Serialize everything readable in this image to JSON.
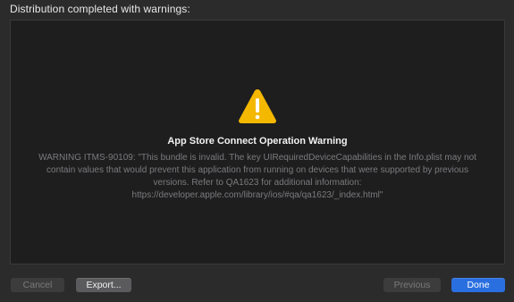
{
  "dialog": {
    "heading": "Distribution completed with warnings:"
  },
  "warning": {
    "icon": "warning-triangle-icon",
    "title": "App Store Connect Operation Warning",
    "message": "WARNING ITMS-90109: \"This bundle is invalid. The key UIRequiredDeviceCapabilities in the Info.plist may not contain values that would prevent this application from running on devices that were supported by previous versions. Refer to QA1623 for additional information: https://developer.apple.com/library/ios/#qa/qa1623/_index.html\"",
    "icon_color": "#f5b800"
  },
  "buttons": {
    "cancel": "Cancel",
    "export": "Export...",
    "previous": "Previous",
    "done": "Done"
  },
  "colors": {
    "accent": "#2a6fe0",
    "background": "#2b2b2c",
    "panel": "#1e1e1f"
  }
}
